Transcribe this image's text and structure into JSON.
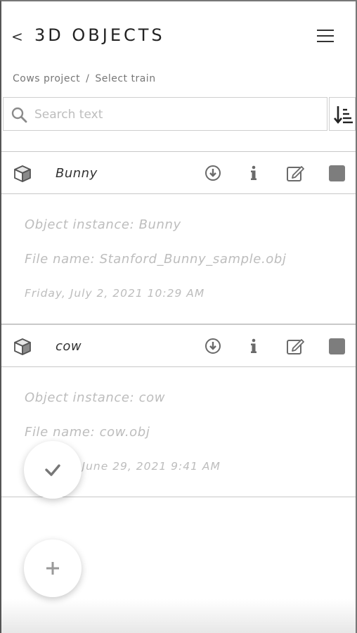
{
  "header": {
    "back_label": "<",
    "title": "3D OBJECTS"
  },
  "breadcrumb": {
    "items": [
      "Cows project",
      "Select train"
    ],
    "separator": "/"
  },
  "search": {
    "placeholder": "Search text",
    "value": ""
  },
  "objects": [
    {
      "name": "Bunny",
      "instance": "Object instance: Bunny",
      "file": "File name: Stanford_Bunny_sample.obj",
      "date": "Friday, July 2, 2021 10:29 AM"
    },
    {
      "name": "cow",
      "instance": "Object instance: cow",
      "file": "File name: cow.obj",
      "date": "Tuesday, June 29, 2021 9:41 AM"
    }
  ],
  "icons": {
    "back": "chevron-left-icon",
    "menu": "hamburger-menu-icon",
    "search": "search-icon",
    "sort": "sort-icon",
    "object": "cube-icon",
    "download": "download-icon",
    "info": "info-icon",
    "edit": "edit-icon",
    "select": "checkbox-icon",
    "confirm": "check-icon",
    "add": "plus-icon"
  },
  "colors": {
    "text": "#333333",
    "muted": "#bdbdbd",
    "icon": "#7d7d7d"
  }
}
